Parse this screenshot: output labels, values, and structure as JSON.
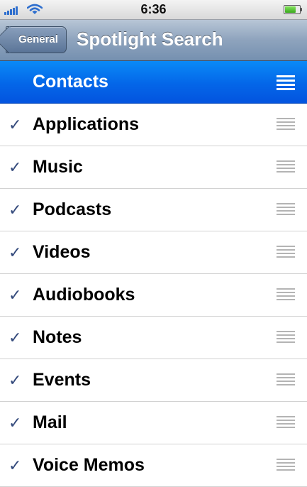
{
  "status_bar": {
    "time": "6:36",
    "signal_bars": 5,
    "battery_level": 0.85,
    "battery_color": "#4cc52b",
    "signal_color": "#2f6fce"
  },
  "nav_bar": {
    "back_label": "General",
    "title": "Spotlight Search"
  },
  "accent_color": "#0a74f0",
  "items": [
    {
      "label": "Contacts",
      "checked": false,
      "selected": true
    },
    {
      "label": "Applications",
      "checked": true,
      "selected": false
    },
    {
      "label": "Music",
      "checked": true,
      "selected": false
    },
    {
      "label": "Podcasts",
      "checked": true,
      "selected": false
    },
    {
      "label": "Videos",
      "checked": true,
      "selected": false
    },
    {
      "label": "Audiobooks",
      "checked": true,
      "selected": false
    },
    {
      "label": "Notes",
      "checked": true,
      "selected": false
    },
    {
      "label": "Events",
      "checked": true,
      "selected": false
    },
    {
      "label": "Mail",
      "checked": true,
      "selected": false
    },
    {
      "label": "Voice Memos",
      "checked": true,
      "selected": false
    }
  ],
  "icons": {
    "checkmark": "checkmark-icon",
    "reorder": "reorder-grip-icon",
    "wifi": "wifi-icon",
    "battery": "battery-icon",
    "signal": "signal-strength-icon"
  }
}
